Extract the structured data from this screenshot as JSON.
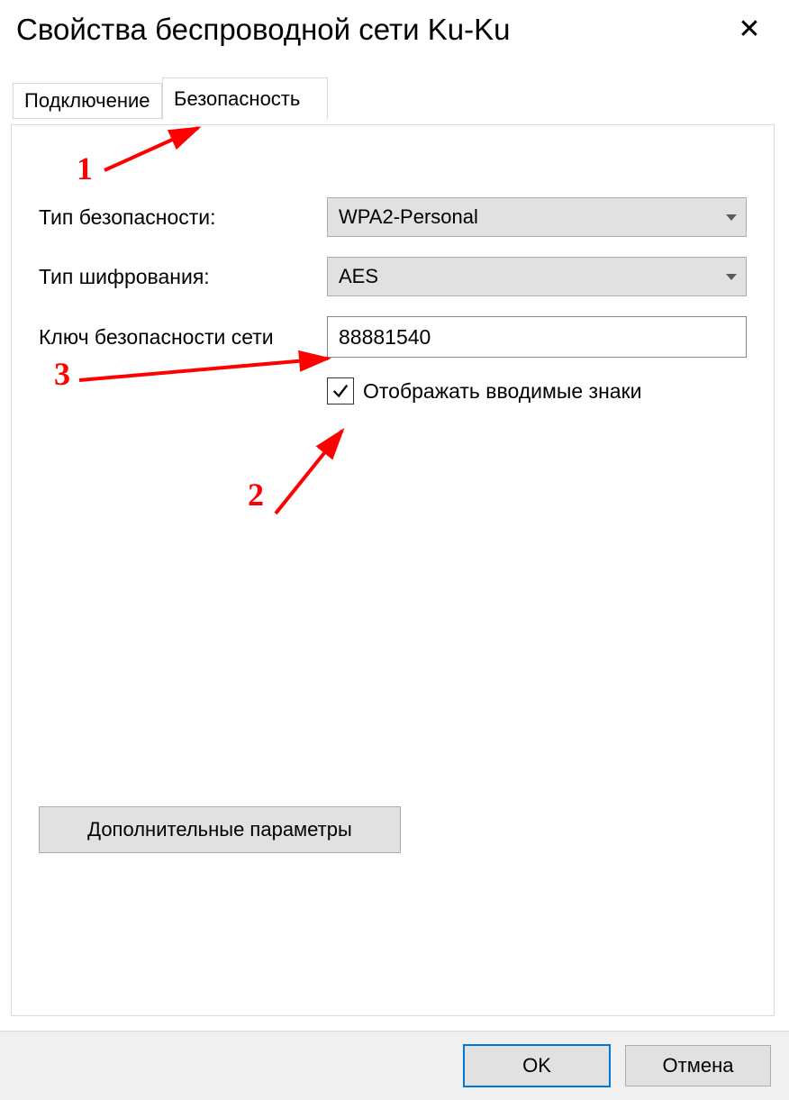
{
  "window": {
    "title": "Свойства беспроводной сети Ku-Ku"
  },
  "tabs": {
    "connection": "Подключение",
    "security": "Безопасность"
  },
  "labels": {
    "security_type": "Тип безопасности:",
    "encryption_type": "Тип шифрования:",
    "network_key": "Ключ безопасности сети",
    "show_chars": "Отображать вводимые знаки",
    "advanced": "Дополнительные параметры"
  },
  "values": {
    "security_type": "WPA2-Personal",
    "encryption_type": "AES",
    "network_key": "88881540",
    "show_chars_checked": true
  },
  "buttons": {
    "ok": "OK",
    "cancel": "Отмена"
  },
  "annotations": {
    "n1": "1",
    "n2": "2",
    "n3": "3"
  }
}
